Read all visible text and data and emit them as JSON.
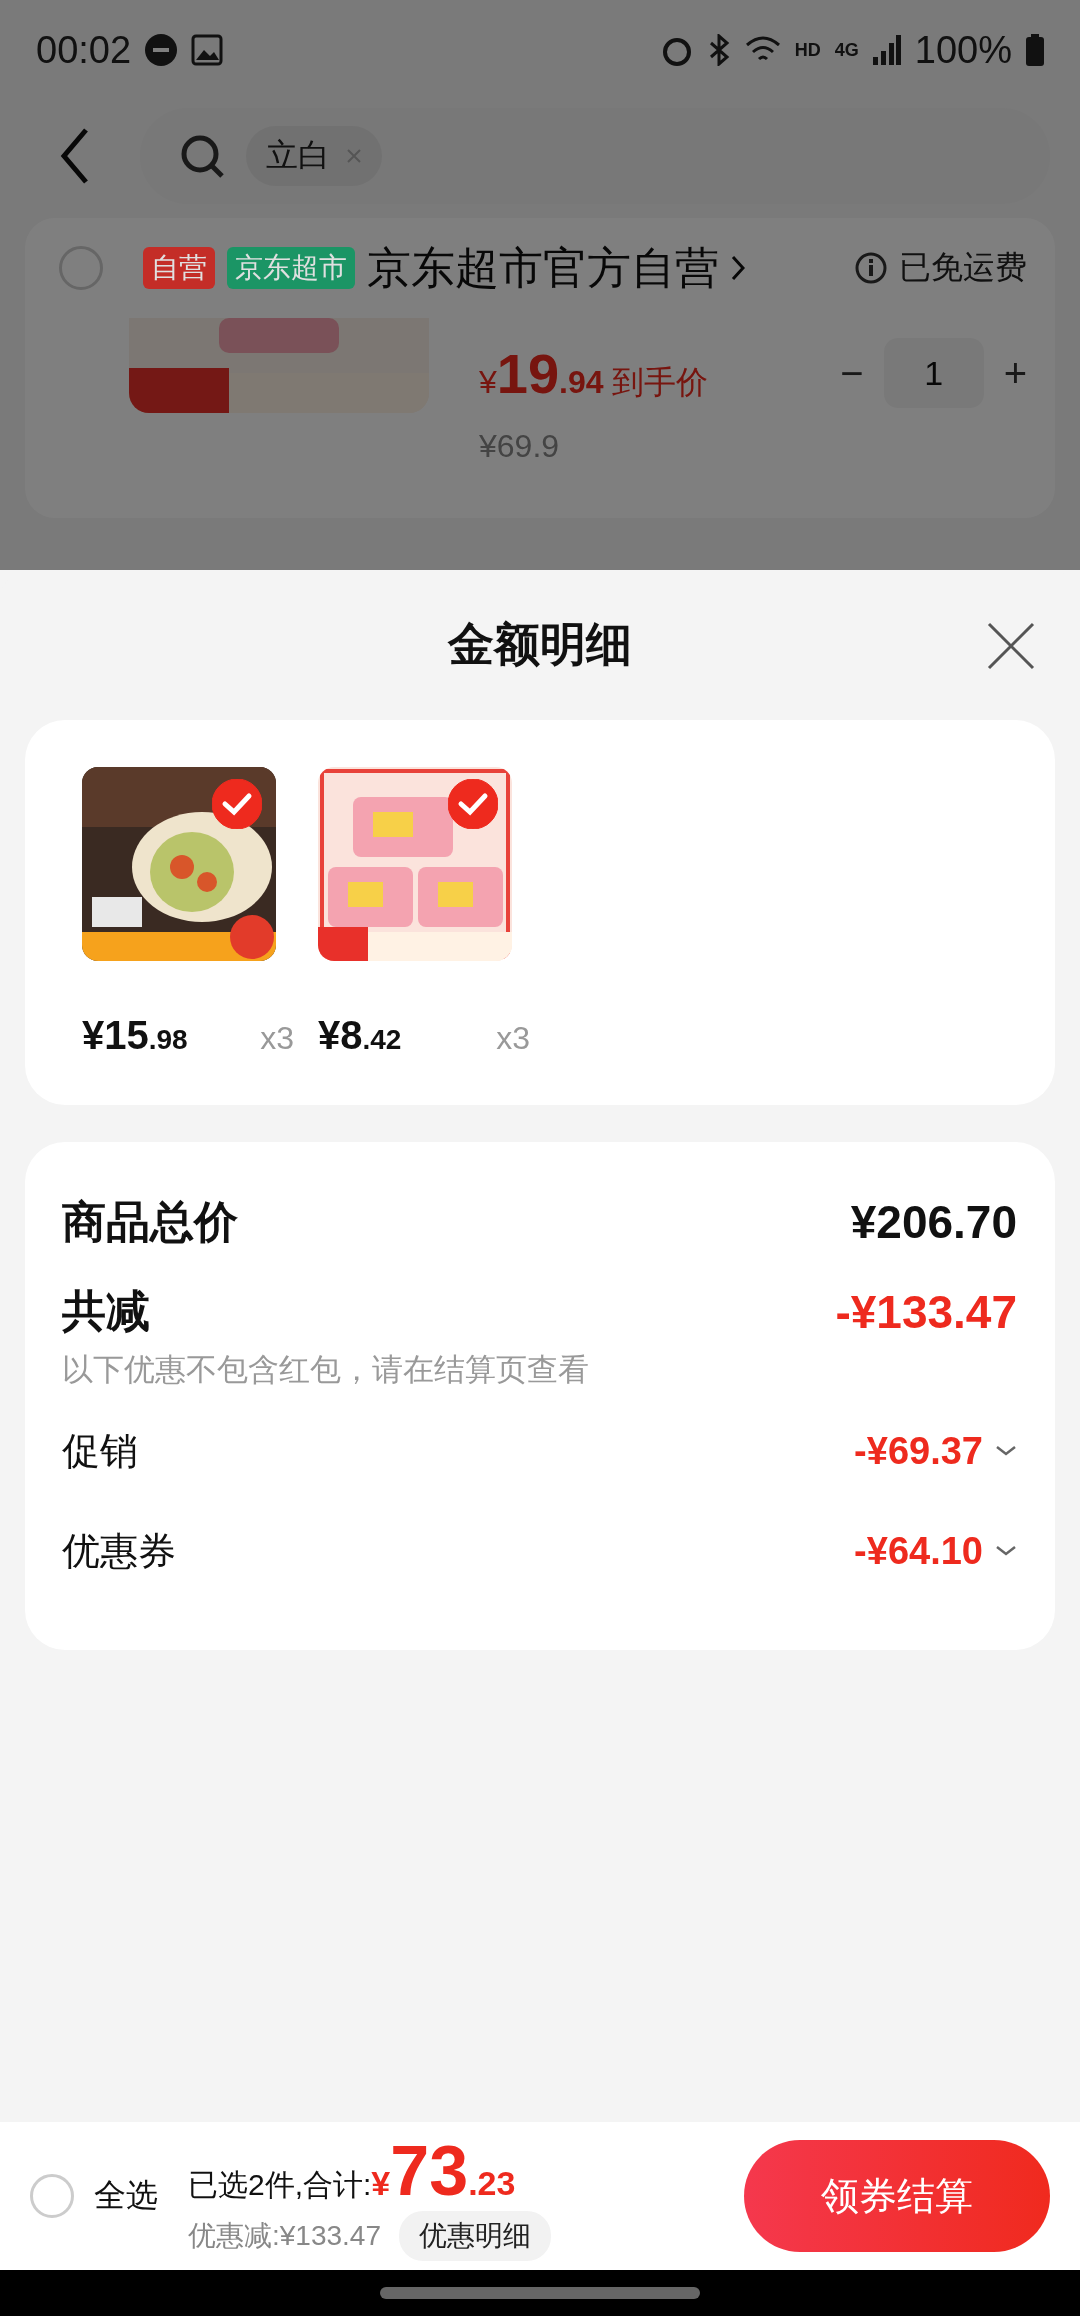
{
  "status_bar": {
    "time": "00:02",
    "network": "4G",
    "hd": "HD",
    "battery": "100%"
  },
  "header": {
    "search_chip": "立白"
  },
  "store_card": {
    "checked": false,
    "tags": [
      {
        "label": "自营",
        "color": "#c42d27"
      },
      {
        "label": "京东超市",
        "color": "#1b9565"
      }
    ],
    "name": "京东超市官方自营",
    "shipping": "已免运费",
    "item": {
      "currency": "¥",
      "price_int": "19",
      "price_dec": ".94",
      "price_note": "到手价",
      "original_price": "¥69.9",
      "quantity": "1",
      "minus": "−",
      "plus": "+"
    }
  },
  "sheet": {
    "title": "金额明细",
    "products": [
      {
        "kind": "picture",
        "currency": "¥",
        "price_int": "15",
        "price_dec": ".98",
        "quantity": "x3",
        "selected": true
      },
      {
        "kind": "picture",
        "currency": "¥",
        "price_int": "8",
        "price_dec": ".42",
        "quantity": "x3",
        "selected": true
      }
    ],
    "total": {
      "label": "商品总价",
      "value": "¥206.70"
    },
    "discount": {
      "label": "共减",
      "value": "-¥133.47",
      "note": "以下优惠不包含红包，请在结算页查看"
    },
    "discount_rows": [
      {
        "label": "促销",
        "value": "-¥69.37",
        "expanded": false
      },
      {
        "label": "优惠券",
        "value": "-¥64.10",
        "expanded": false
      }
    ]
  },
  "bottom_bar": {
    "select_all": {
      "label": "全选",
      "checked": false
    },
    "selected_text": "已选2件,合计:",
    "currency": "¥",
    "total_int": "73",
    "total_dec": ".23",
    "saved": "优惠减:¥133.47",
    "detail_button": "优惠明细",
    "checkout_button": "领券结算"
  }
}
